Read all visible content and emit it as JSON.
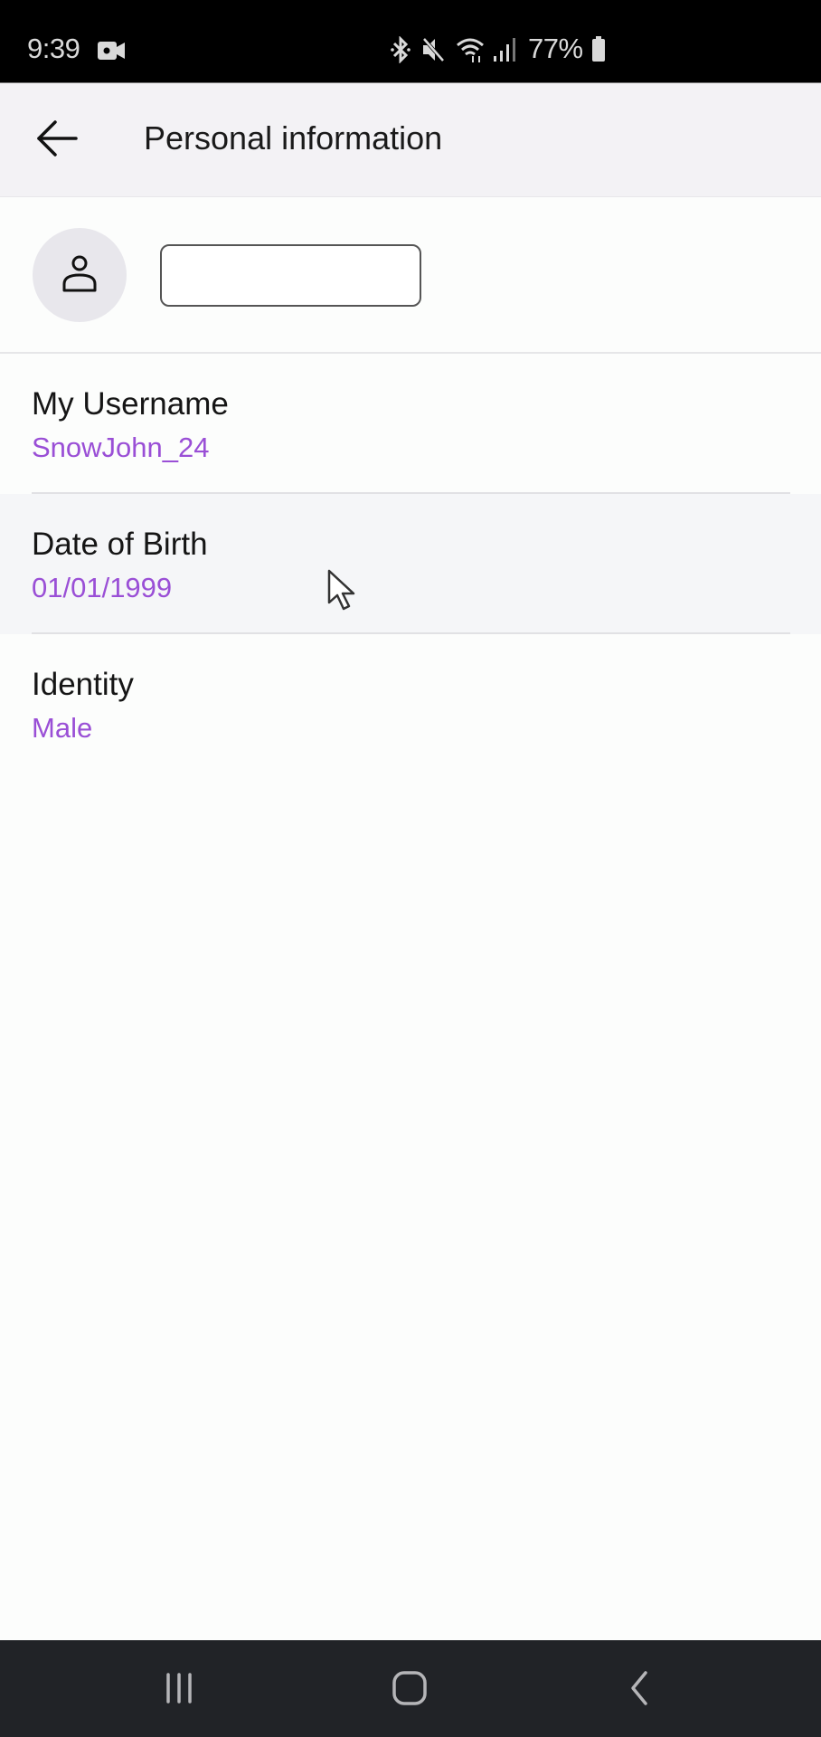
{
  "status_bar": {
    "time": "9:39",
    "battery_percent": "77%",
    "icons": [
      "video-camera-icon",
      "bluetooth-icon",
      "mute-icon",
      "wifi-icon",
      "signal-icon",
      "battery-icon"
    ]
  },
  "header": {
    "back_icon": "arrow-left-icon",
    "title": "Personal information"
  },
  "profile": {
    "avatar_icon": "person-icon",
    "name_input_value": "",
    "name_input_placeholder": ""
  },
  "info_items": [
    {
      "label": "My Username",
      "value": "SnowJohn_24"
    },
    {
      "label": "Date of Birth",
      "value": "01/01/1999"
    },
    {
      "label": "Identity",
      "value": "Male"
    }
  ],
  "colors": {
    "accent": "#9a4fd6",
    "header_bg": "#f3f2f5",
    "highlight_bg": "#f5f6f8",
    "nav_bg": "#212327"
  },
  "nav_bar": {
    "buttons": [
      "recent-apps",
      "home",
      "back"
    ]
  }
}
